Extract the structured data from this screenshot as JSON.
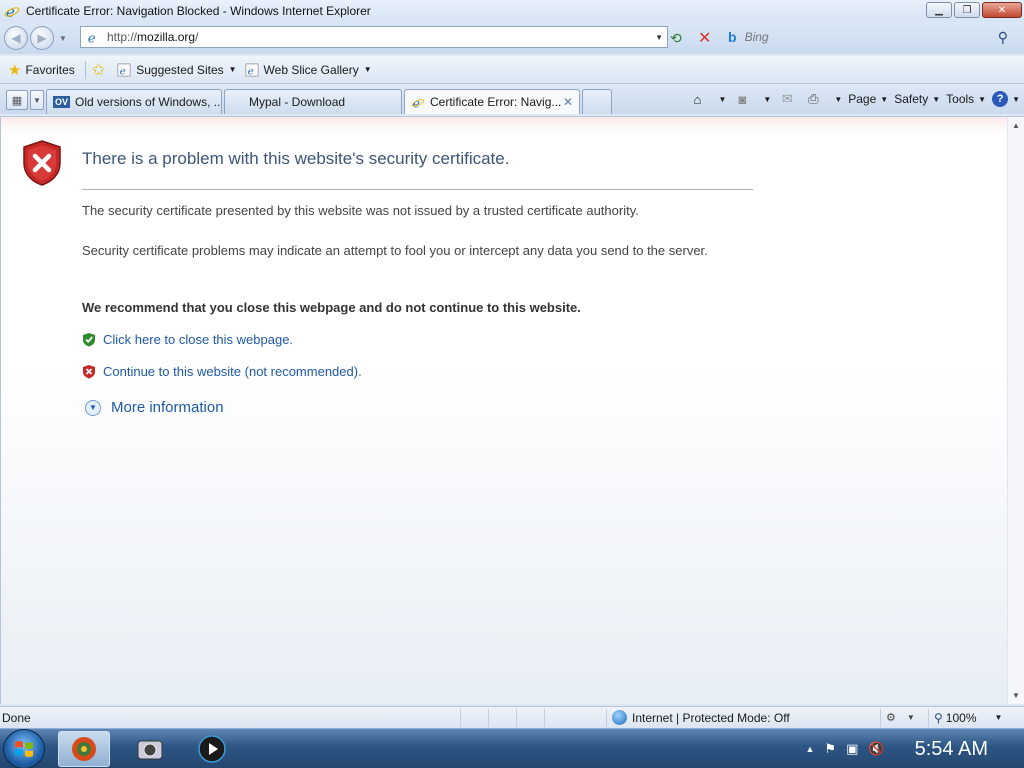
{
  "window": {
    "title": "Certificate Error: Navigation Blocked - Windows Internet Explorer",
    "buttons": {
      "minimize": "▁",
      "maximize": "❐",
      "close": "✕"
    }
  },
  "address_bar": {
    "url_prefix": "http://",
    "url_host": "mozilla.org",
    "url_suffix": "/"
  },
  "search": {
    "placeholder": "Bing"
  },
  "favorites_bar": {
    "favorites_label": "Favorites",
    "items": [
      {
        "label": "Suggested Sites"
      },
      {
        "label": "Web Slice Gallery"
      }
    ]
  },
  "tabs": [
    {
      "label": "Old versions of Windows, ...",
      "icon": "ov-icon",
      "badge": "OV",
      "active": false
    },
    {
      "label": "Mypal - Download",
      "icon": "none",
      "active": false
    },
    {
      "label": "Certificate Error: Navig...",
      "icon": "ie-icon",
      "active": true
    }
  ],
  "command_bar": {
    "page": "Page",
    "safety": "Safety",
    "tools": "Tools"
  },
  "content": {
    "heading": "There is a problem with this website's security certificate.",
    "p1": "The security certificate presented by this website was not issued by a trusted certificate authority.",
    "p2": "Security certificate problems may indicate an attempt to fool you or intercept any data you send to the server.",
    "recommend": "We recommend that you close this webpage and do not continue to this website.",
    "link_close": "Click here to close this webpage.",
    "link_continue": "Continue to this website (not recommended).",
    "more_info": "More information"
  },
  "status_bar": {
    "status": "Done",
    "zone": "Internet | Protected Mode: Off",
    "zoom": "100%"
  },
  "taskbar": {
    "clock": "5:54 AM"
  },
  "colors": {
    "link": "#1e5aa8",
    "heading": "#3e5676",
    "error_red": "#c62828",
    "safe_green": "#2e8b2e"
  }
}
